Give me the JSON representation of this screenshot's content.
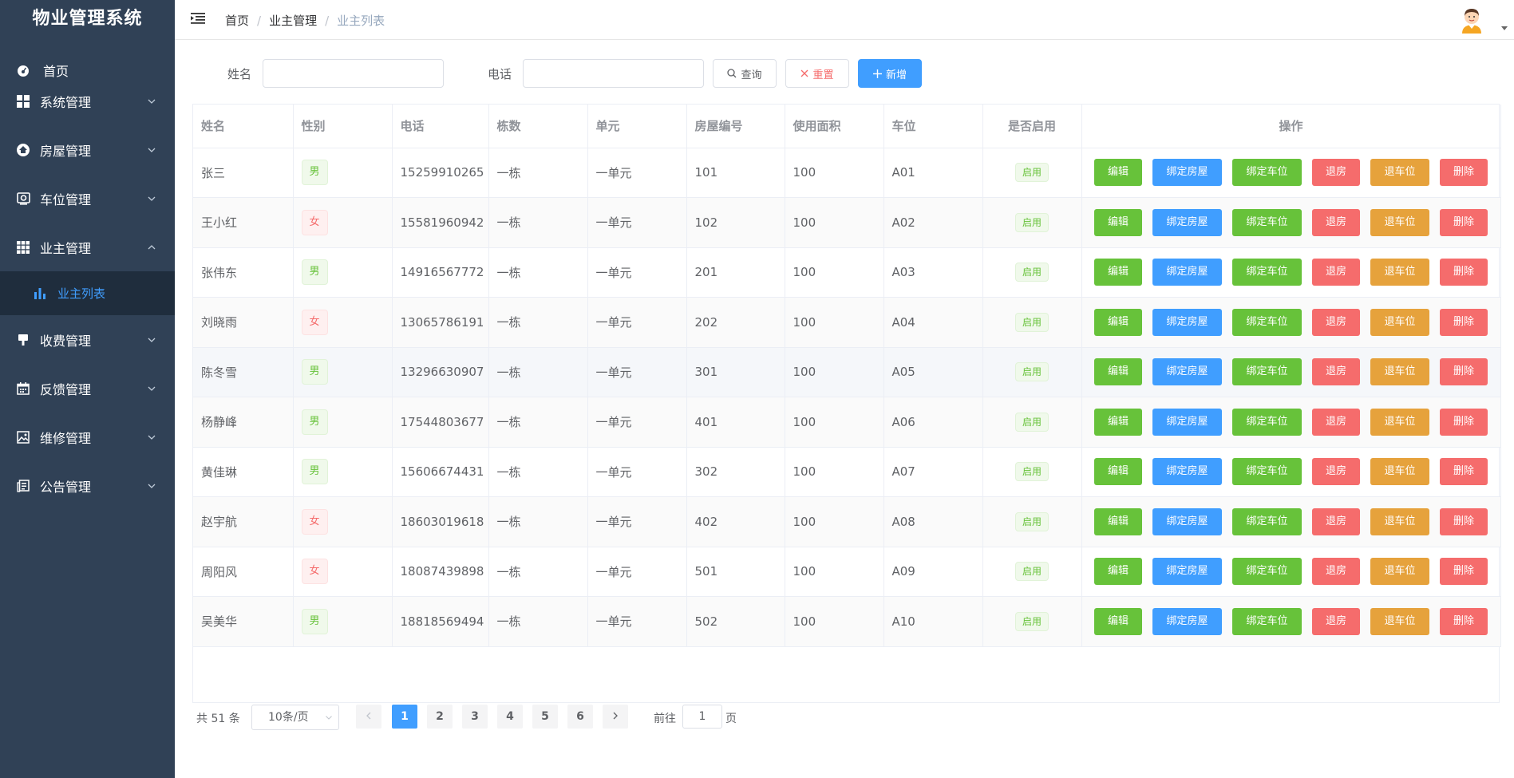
{
  "app": {
    "title": "物业管理系统"
  },
  "sidebar": {
    "items": [
      {
        "label": "首页",
        "icon": "dashboard-icon"
      },
      {
        "label": "系统管理",
        "icon": "grid-icon"
      },
      {
        "label": "房屋管理",
        "icon": "house-icon"
      },
      {
        "label": "车位管理",
        "icon": "parking-icon"
      },
      {
        "label": "业主管理",
        "icon": "table-icon",
        "expanded": true
      },
      {
        "label": "收费管理",
        "icon": "fee-icon"
      },
      {
        "label": "反馈管理",
        "icon": "calendar-icon"
      },
      {
        "label": "维修管理",
        "icon": "picture-icon"
      },
      {
        "label": "公告管理",
        "icon": "notice-icon"
      }
    ],
    "sub_items": [
      {
        "label": "业主列表",
        "icon": "bar-chart-icon",
        "active": true
      }
    ]
  },
  "header": {
    "breadcrumb": [
      "首页",
      "业主管理",
      "业主列表"
    ]
  },
  "search": {
    "name_label": "姓名",
    "name_value": "",
    "phone_label": "电话",
    "phone_value": "",
    "query_label": "查询",
    "reset_label": "重置",
    "add_label": "新增"
  },
  "table": {
    "columns": [
      "姓名",
      "性别",
      "电话",
      "栋数",
      "单元",
      "房屋编号",
      "使用面积",
      "车位",
      "是否启用",
      "操作"
    ],
    "rows": [
      {
        "name": "张三",
        "gender": "男",
        "phone": "15259910265",
        "building": "一栋",
        "unit": "一单元",
        "room": "101",
        "area": "100",
        "parking": "A01",
        "status": "启用"
      },
      {
        "name": "王小红",
        "gender": "女",
        "phone": "15581960942",
        "building": "一栋",
        "unit": "一单元",
        "room": "102",
        "area": "100",
        "parking": "A02",
        "status": "启用"
      },
      {
        "name": "张伟东",
        "gender": "男",
        "phone": "14916567772",
        "building": "一栋",
        "unit": "一单元",
        "room": "201",
        "area": "100",
        "parking": "A03",
        "status": "启用"
      },
      {
        "name": "刘晓雨",
        "gender": "女",
        "phone": "13065786191",
        "building": "一栋",
        "unit": "一单元",
        "room": "202",
        "area": "100",
        "parking": "A04",
        "status": "启用"
      },
      {
        "name": "陈冬雪",
        "gender": "男",
        "phone": "13296630907",
        "building": "一栋",
        "unit": "一单元",
        "room": "301",
        "area": "100",
        "parking": "A05",
        "status": "启用"
      },
      {
        "name": "杨静峰",
        "gender": "男",
        "phone": "17544803677",
        "building": "一栋",
        "unit": "一单元",
        "room": "401",
        "area": "100",
        "parking": "A06",
        "status": "启用"
      },
      {
        "name": "黄佳琳",
        "gender": "男",
        "phone": "15606674431",
        "building": "一栋",
        "unit": "一单元",
        "room": "302",
        "area": "100",
        "parking": "A07",
        "status": "启用"
      },
      {
        "name": "赵宇航",
        "gender": "女",
        "phone": "18603019618",
        "building": "一栋",
        "unit": "一单元",
        "room": "402",
        "area": "100",
        "parking": "A08",
        "status": "启用"
      },
      {
        "name": "周阳风",
        "gender": "女",
        "phone": "18087439898",
        "building": "一栋",
        "unit": "一单元",
        "room": "501",
        "area": "100",
        "parking": "A09",
        "status": "启用"
      },
      {
        "name": "吴美华",
        "gender": "男",
        "phone": "18818569494",
        "building": "一栋",
        "unit": "一单元",
        "room": "502",
        "area": "100",
        "parking": "A10",
        "status": "启用"
      }
    ],
    "actions": [
      "编辑",
      "绑定房屋",
      "绑定车位",
      "退房",
      "退车位",
      "删除"
    ]
  },
  "pagination": {
    "total_text": "共 51 条",
    "page_size": "10条/页",
    "pages": [
      "1",
      "2",
      "3",
      "4",
      "5",
      "6"
    ],
    "current_page": "1",
    "goto_label": "前往",
    "goto_value": "1",
    "goto_suffix": "页"
  },
  "colors": {
    "sidebar_bg": "#304156",
    "submenu_bg": "#1f2d3d",
    "primary": "#409eff",
    "success": "#67c23a",
    "danger": "#f56c6c",
    "warning": "#e6a23c"
  }
}
